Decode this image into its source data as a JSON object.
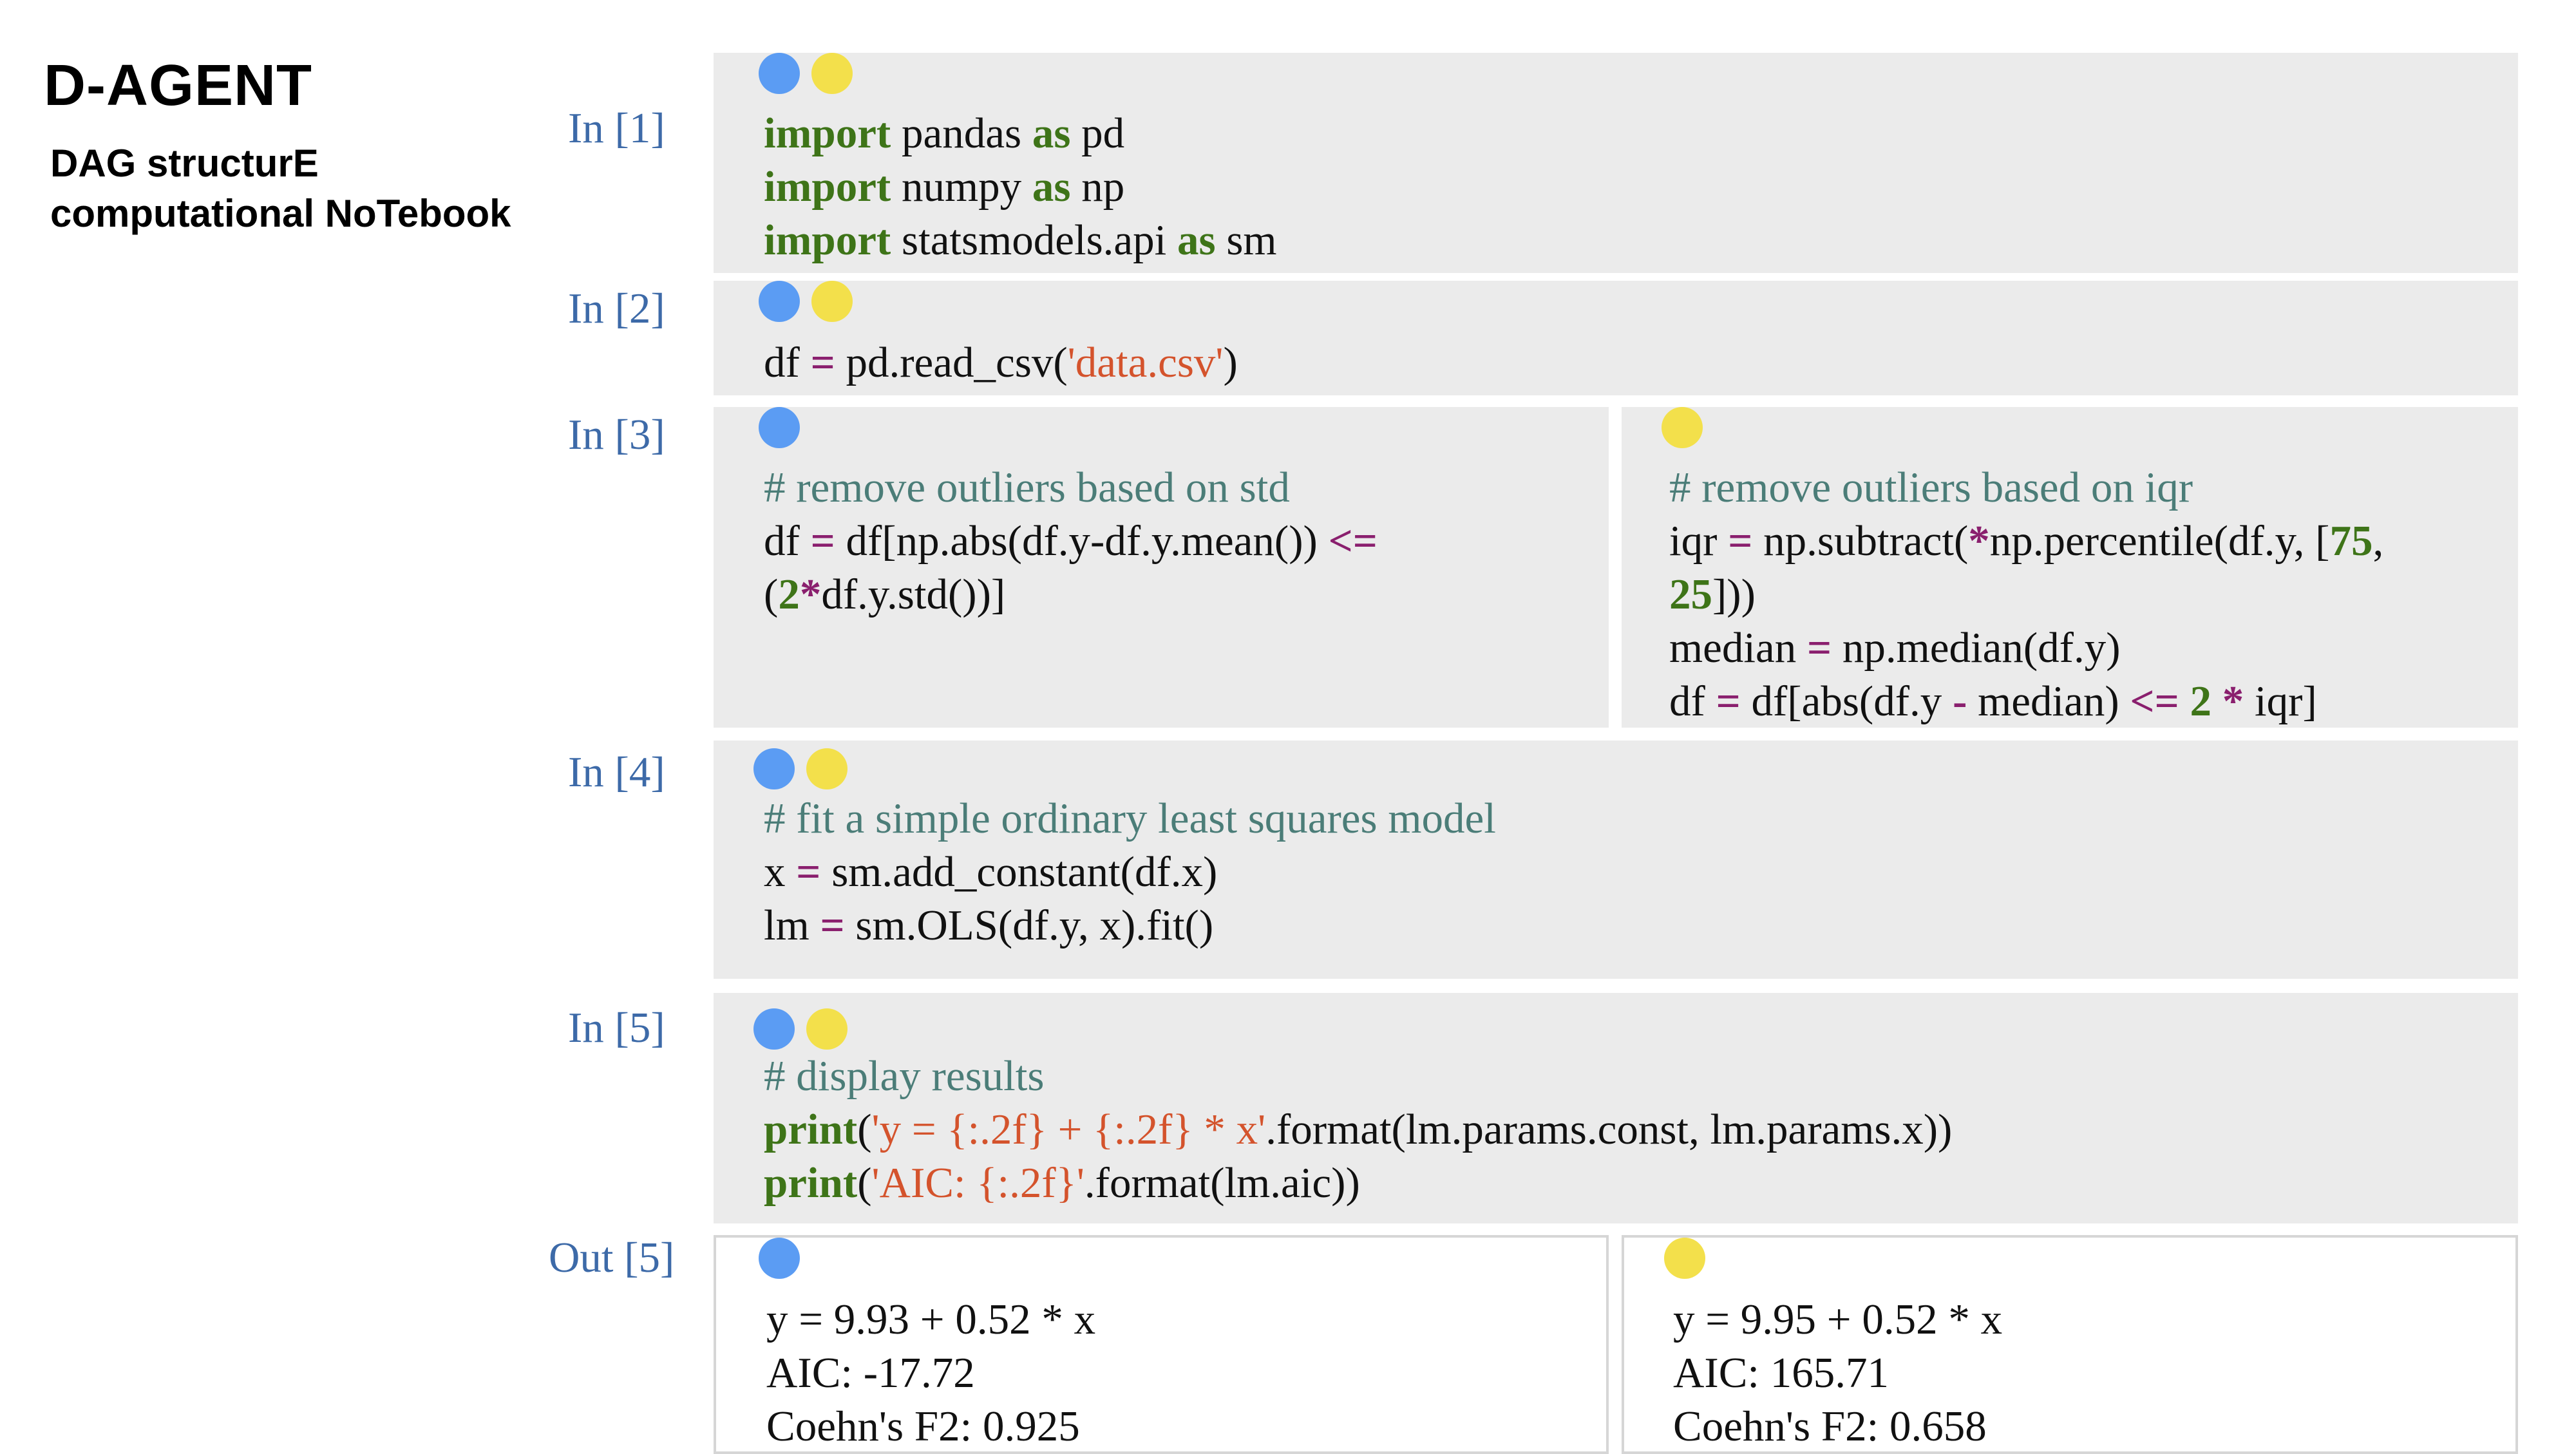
{
  "brand": {
    "title": "D-AGENT",
    "subtitle_line1": "DAG structurE",
    "subtitle_line2": "computational NoTebook"
  },
  "colors": {
    "branch_a": "#5b9cf3",
    "branch_b": "#f3e04b",
    "keyword": "#3e7418",
    "operator": "#8a1f6e",
    "string": "#d4532c",
    "comment": "#4b7d78",
    "prompt": "#3d6aa8",
    "cell_bg": "#ebebeb"
  },
  "cells": [
    {
      "prompt": "In [1]",
      "branches": [
        "blue",
        "yellow"
      ],
      "lines": [
        [
          {
            "t": "kw",
            "v": "import"
          },
          {
            "t": "p",
            "v": " pandas "
          },
          {
            "t": "kw",
            "v": "as"
          },
          {
            "t": "p",
            "v": " pd"
          }
        ],
        [
          {
            "t": "kw",
            "v": "import"
          },
          {
            "t": "p",
            "v": " numpy "
          },
          {
            "t": "kw",
            "v": "as"
          },
          {
            "t": "p",
            "v": " np"
          }
        ],
        [
          {
            "t": "kw",
            "v": "import"
          },
          {
            "t": "p",
            "v": " statsmodels.api "
          },
          {
            "t": "kw",
            "v": "as"
          },
          {
            "t": "p",
            "v": " sm"
          }
        ]
      ]
    },
    {
      "prompt": "In [2]",
      "branches": [
        "blue",
        "yellow"
      ],
      "lines": [
        [
          {
            "t": "p",
            "v": "df "
          },
          {
            "t": "op",
            "v": "="
          },
          {
            "t": "p",
            "v": " pd.read_csv("
          },
          {
            "t": "str",
            "v": "'data.csv'"
          },
          {
            "t": "p",
            "v": ")"
          }
        ]
      ]
    },
    {
      "prompt": "In [3]",
      "split": true,
      "left": {
        "branch": "blue",
        "lines": [
          [
            {
              "t": "cm",
              "v": "# remove outliers based on std"
            }
          ],
          [
            {
              "t": "p",
              "v": "df "
            },
            {
              "t": "op",
              "v": "="
            },
            {
              "t": "p",
              "v": " df[np.abs(df.y-df.y.mean()) "
            },
            {
              "t": "op",
              "v": "<="
            }
          ],
          [
            {
              "t": "p",
              "v": "("
            },
            {
              "t": "num",
              "v": "2"
            },
            {
              "t": "op",
              "v": "*"
            },
            {
              "t": "p",
              "v": "df.y.std())]"
            }
          ]
        ]
      },
      "right": {
        "branch": "yellow",
        "lines": [
          [
            {
              "t": "cm",
              "v": "# remove outliers based on iqr"
            }
          ],
          [
            {
              "t": "p",
              "v": "iqr "
            },
            {
              "t": "op",
              "v": "="
            },
            {
              "t": "p",
              "v": " np.subtract("
            },
            {
              "t": "op",
              "v": "*"
            },
            {
              "t": "p",
              "v": "np.percentile(df.y, ["
            },
            {
              "t": "num",
              "v": "75"
            },
            {
              "t": "p",
              "v": ","
            }
          ],
          [
            {
              "t": "num",
              "v": "25"
            },
            {
              "t": "p",
              "v": "]))"
            }
          ],
          [
            {
              "t": "p",
              "v": "median "
            },
            {
              "t": "op",
              "v": "="
            },
            {
              "t": "p",
              "v": " np.median(df.y)"
            }
          ],
          [
            {
              "t": "p",
              "v": "df "
            },
            {
              "t": "op",
              "v": "="
            },
            {
              "t": "p",
              "v": " df[abs(df.y "
            },
            {
              "t": "op",
              "v": "-"
            },
            {
              "t": "p",
              "v": " median) "
            },
            {
              "t": "op",
              "v": "<="
            },
            {
              "t": "p",
              "v": " "
            },
            {
              "t": "num",
              "v": "2"
            },
            {
              "t": "p",
              "v": " "
            },
            {
              "t": "op",
              "v": "*"
            },
            {
              "t": "p",
              "v": " iqr]"
            }
          ]
        ]
      }
    },
    {
      "prompt": "In [4]",
      "branches": [
        "blue",
        "yellow"
      ],
      "lines": [
        [
          {
            "t": "cm",
            "v": "# fit a simple ordinary least squares model"
          }
        ],
        [
          {
            "t": "p",
            "v": "x "
          },
          {
            "t": "op",
            "v": "="
          },
          {
            "t": "p",
            "v": " sm.add_constant(df.x)"
          }
        ],
        [
          {
            "t": "p",
            "v": "lm "
          },
          {
            "t": "op",
            "v": "="
          },
          {
            "t": "p",
            "v": " sm.OLS(df.y, x).fit()"
          }
        ]
      ]
    },
    {
      "prompt": "In [5]",
      "branches": [
        "blue",
        "yellow"
      ],
      "lines": [
        [
          {
            "t": "cm",
            "v": "# display results"
          }
        ],
        [
          {
            "t": "kw",
            "v": "print"
          },
          {
            "t": "p",
            "v": "("
          },
          {
            "t": "str",
            "v": "'y = {:.2f} + {:.2f} * x'"
          },
          {
            "t": "p",
            "v": ".format(lm.params.const, lm.params.x))"
          }
        ],
        [
          {
            "t": "kw",
            "v": "print"
          },
          {
            "t": "p",
            "v": "("
          },
          {
            "t": "str",
            "v": "'AIC: {:.2f}'"
          },
          {
            "t": "p",
            "v": ".format(lm.aic))"
          }
        ]
      ]
    }
  ],
  "output": {
    "prompt": "Out [5]",
    "left": {
      "branch": "blue",
      "lines": [
        "y = 9.93 + 0.52 * x",
        "AIC: -17.72",
        "Coehn's F2: 0.925"
      ]
    },
    "right": {
      "branch": "yellow",
      "lines": [
        "y = 9.95 + 0.52 * x",
        "AIC: 165.71",
        "Coehn's F2: 0.658"
      ]
    }
  }
}
